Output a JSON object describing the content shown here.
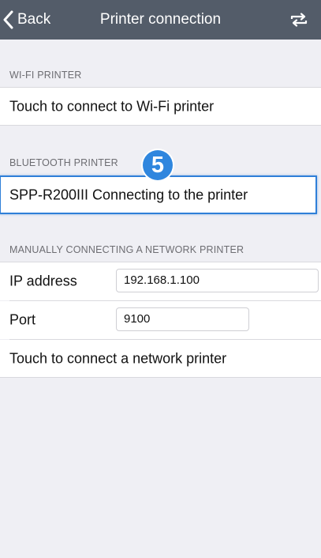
{
  "navbar": {
    "back_label": "Back",
    "title": "Printer connection",
    "refresh_icon": "refresh-icon"
  },
  "wifi": {
    "header": "WI-FI PRINTER",
    "action_label": "Touch to connect to Wi-Fi printer"
  },
  "bluetooth": {
    "header": "BLUETOOTH PRINTER",
    "status_label": "SPP-R200III Connecting to the printer",
    "step_badge": "5"
  },
  "network": {
    "header": "MANUALLY CONNECTING A NETWORK PRINTER",
    "ip_label": "IP address",
    "ip_value": "192.168.1.100",
    "port_label": "Port",
    "port_value": "9100",
    "action_label": "Touch to connect a network printer"
  },
  "colors": {
    "navbar": "#535c69",
    "background": "#efeff4",
    "accent": "#2f86de"
  }
}
